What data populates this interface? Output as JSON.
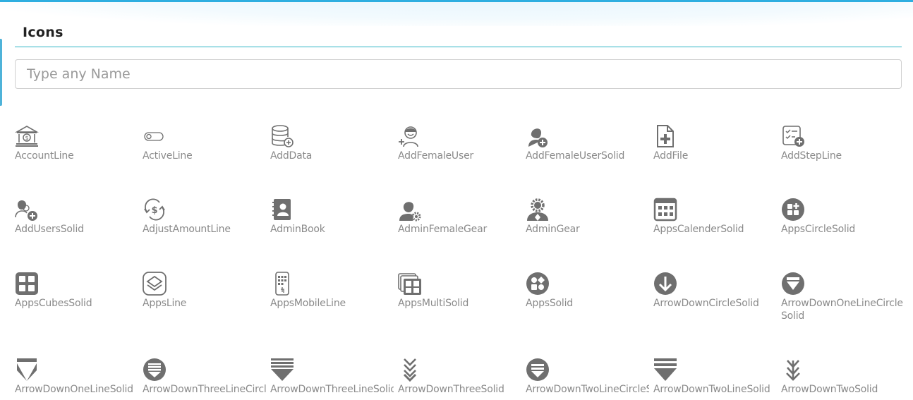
{
  "page": {
    "title": "Icons"
  },
  "search": {
    "placeholder": "Type any Name",
    "value": ""
  },
  "colors": {
    "accent": "#2eaee0",
    "rule": "#2db3c4",
    "icon": "#6f6f6f",
    "label": "#8a8a8a"
  },
  "icons": [
    {
      "label": "AccountLine",
      "icon": "bank-icon"
    },
    {
      "label": "ActiveLine",
      "icon": "toggle-icon"
    },
    {
      "label": "AddData",
      "icon": "database-add-icon"
    },
    {
      "label": "AddFemaleUser",
      "icon": "female-user-add-icon"
    },
    {
      "label": "AddFemaleUserSolid",
      "icon": "female-user-add-solid-icon"
    },
    {
      "label": "AddFile",
      "icon": "file-add-icon"
    },
    {
      "label": "AddStepLine",
      "icon": "checklist-add-icon"
    },
    {
      "label": "AddUsersSolid",
      "icon": "users-add-icon"
    },
    {
      "label": "AdjustAmountLine",
      "icon": "dollar-cycle-icon"
    },
    {
      "label": "AdminBook",
      "icon": "contact-book-icon"
    },
    {
      "label": "AdminFemaleGear",
      "icon": "female-gear-icon"
    },
    {
      "label": "AdminGear",
      "icon": "user-gear-icon"
    },
    {
      "label": "AppsCalenderSolid",
      "icon": "calendar-grid-icon"
    },
    {
      "label": "AppsCircleSolid",
      "icon": "apps-circle-icon"
    },
    {
      "label": "AppsCubesSolid",
      "icon": "apps-cubes-icon"
    },
    {
      "label": "AppsLine",
      "icon": "layers-icon"
    },
    {
      "label": "AppsMobileLine",
      "icon": "mobile-apps-icon"
    },
    {
      "label": "AppsMultiSolid",
      "icon": "apps-multi-icon"
    },
    {
      "label": "AppsSolid",
      "icon": "apps-solid-icon"
    },
    {
      "label": "ArrowDownCircleSolid",
      "icon": "arrow-down-circle-icon"
    },
    {
      "label": "ArrowDownOneLineCircleSolid",
      "icon": "arrow-down-one-line-circle-icon"
    },
    {
      "label": "ArrowDownOneLineSolid",
      "icon": "arrow-down-one-line-icon"
    },
    {
      "label": "ArrowDownThreeLineCircl",
      "icon": "arrow-down-three-line-circle-icon"
    },
    {
      "label": "ArrowDownThreeLineSolid",
      "icon": "arrow-down-three-line-icon"
    },
    {
      "label": "ArrowDownThreeSolid",
      "icon": "arrow-down-three-icon"
    },
    {
      "label": "ArrowDownTwoLineCircleS",
      "icon": "arrow-down-two-line-circle-icon"
    },
    {
      "label": "ArrowDownTwoLineSolid",
      "icon": "arrow-down-two-line-icon"
    },
    {
      "label": "ArrowDownTwoSolid",
      "icon": "arrow-down-two-icon"
    }
  ]
}
